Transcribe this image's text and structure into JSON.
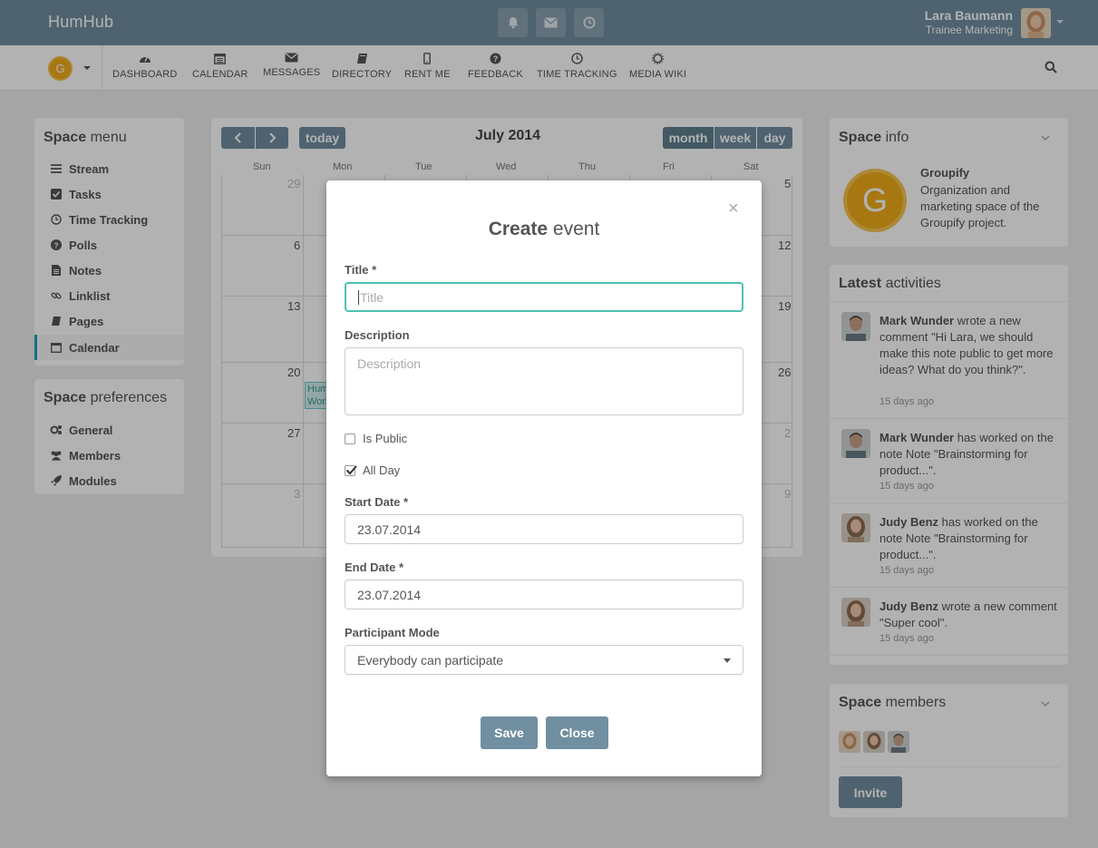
{
  "topbar": {
    "brand": "HumHub",
    "user_name": "Lara Baumann",
    "user_title": "Trainee Marketing"
  },
  "space": {
    "logo_letter": "G"
  },
  "nav": {
    "items": [
      {
        "label": "DASHBOARD",
        "icon": "dashboard-icon"
      },
      {
        "label": "CALENDAR",
        "icon": "calendar-icon"
      },
      {
        "label": "MESSAGES",
        "icon": "envelope-icon"
      },
      {
        "label": "DIRECTORY",
        "icon": "book-icon"
      },
      {
        "label": "RENT ME",
        "icon": "mobile-icon"
      },
      {
        "label": "FEEDBACK",
        "icon": "question-icon"
      },
      {
        "label": "TIME TRACKING",
        "icon": "clock-icon"
      },
      {
        "label": "MEDIA WIKI",
        "icon": "gear-icon"
      }
    ]
  },
  "space_menu": {
    "title_bold": "Space",
    "title_rest": " menu",
    "items": [
      {
        "label": "Stream",
        "icon": "list-icon"
      },
      {
        "label": "Tasks",
        "icon": "check-square-icon"
      },
      {
        "label": "Time Tracking",
        "icon": "clock-icon"
      },
      {
        "label": "Polls",
        "icon": "question-icon"
      },
      {
        "label": "Notes",
        "icon": "file-icon"
      },
      {
        "label": "Linklist",
        "icon": "link-icon"
      },
      {
        "label": "Pages",
        "icon": "book-icon"
      },
      {
        "label": "Calendar",
        "icon": "calendar-icon"
      }
    ]
  },
  "space_prefs": {
    "title_bold": "Space",
    "title_rest": " preferences",
    "items": [
      {
        "label": "General",
        "icon": "cogs-icon"
      },
      {
        "label": "Members",
        "icon": "users-icon"
      },
      {
        "label": "Modules",
        "icon": "rocket-icon"
      }
    ]
  },
  "calendar": {
    "title": "July 2014",
    "today_label": "today",
    "views": [
      "month",
      "week",
      "day"
    ],
    "weekdays": [
      "Sun",
      "Mon",
      "Tue",
      "Wed",
      "Thu",
      "Fri",
      "Sat"
    ],
    "left_days": [
      "29",
      "6",
      "13",
      "20",
      "27",
      "3"
    ],
    "right_days": [
      "5",
      "12",
      "19",
      "26",
      "2",
      "9"
    ],
    "event_text": "Hum Work"
  },
  "space_info": {
    "title_bold": "Space",
    "title_rest": " info",
    "name": "Groupify",
    "description": "Organization and marketing space of the Groupify project.",
    "logo_letter": "G"
  },
  "activities": {
    "title_bold": "Latest",
    "title_rest": " activities",
    "items": [
      {
        "user": "Mark Wunder",
        "text": " wrote a new comment \"Hi Lara, we should make this note public to get more ideas? What do you think?\".",
        "time": "15 days ago"
      },
      {
        "user": "Mark Wunder",
        "text": " has worked on the note Note \"Brainstorming for product...\".",
        "time": "15 days ago"
      },
      {
        "user": "Judy Benz",
        "text": " has worked on the note Note \"Brainstorming for product...\".",
        "time": "15 days ago"
      },
      {
        "user": "Judy Benz",
        "text": " wrote a new comment \"Super cool\".",
        "time": "15 days ago"
      }
    ]
  },
  "space_members": {
    "title_bold": "Space",
    "title_rest": " members",
    "invite_label": "Invite"
  },
  "modal": {
    "close_glyph": "×",
    "title_bold": "Create",
    "title_rest": " event",
    "title_label": "Title *",
    "title_placeholder": "Title",
    "description_label": "Description",
    "description_placeholder": "Description",
    "is_public_label": "Is Public",
    "is_public_checked": false,
    "all_day_label": "All Day",
    "all_day_checked": true,
    "start_label": "Start Date *",
    "start_value": "23.07.2014",
    "end_label": "End Date *",
    "end_value": "23.07.2014",
    "participant_label": "Participant Mode",
    "participant_value": "Everybody can participate",
    "save_label": "Save",
    "close_label": "Close"
  },
  "colors": {
    "primary": "#708fa0",
    "accent": "#21a1b3",
    "focus": "#4fc2b3",
    "space_logo": "#f0ad1a"
  }
}
